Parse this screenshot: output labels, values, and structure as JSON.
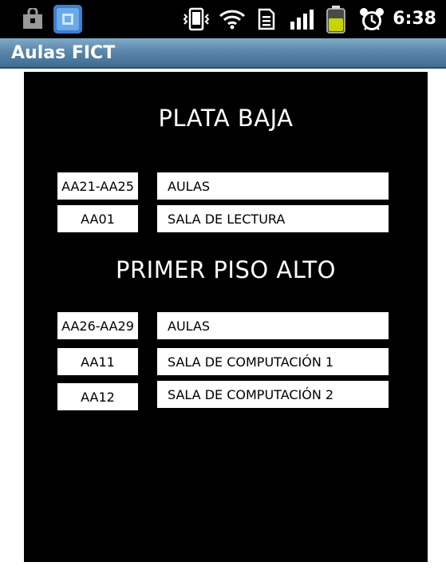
{
  "status_bar": {
    "time": "6:38",
    "icons": [
      "shopping-bag-icon",
      "app-notification-icon",
      "vibrate-icon",
      "wifi-icon",
      "sim-data-icon",
      "signal-bars-icon",
      "battery-icon",
      "alarm-icon"
    ]
  },
  "app": {
    "title": "Aulas FICT"
  },
  "sections": [
    {
      "title": "PLATA BAJA",
      "rows": [
        {
          "code": "AA21-AA25",
          "description": "AULAS"
        },
        {
          "code": "AA01",
          "description": "SALA DE LECTURA"
        }
      ]
    },
    {
      "title": "PRIMER PISO ALTO",
      "rows": [
        {
          "code": "AA26-AA29",
          "description": "AULAS"
        },
        {
          "code": "AA11",
          "description": "SALA DE COMPUTACIÓN 1"
        },
        {
          "code": "AA12",
          "description": "SALA DE COMPUTACIÓN 2"
        }
      ]
    }
  ],
  "colors": {
    "title_bar_top": "#7fa9c7",
    "title_bar_bottom": "#3f6d92",
    "battery": "#c8d400"
  }
}
